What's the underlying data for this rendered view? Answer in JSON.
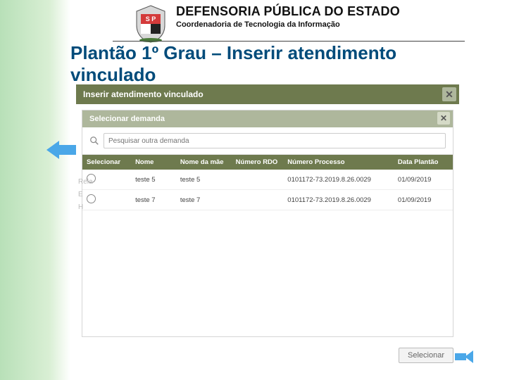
{
  "header": {
    "org": "DEFENSORIA PÚBLICA DO ESTADO",
    "sub": "Coordenadoria de Tecnologia da Informação"
  },
  "page_title_line1": "Plantão 1º Grau – Inserir atendimento",
  "page_title_line2": "vinculado",
  "modal": {
    "title": "Inserir atendimento vinculado",
    "close": "✕",
    "sub_title": "Selecionar demanda",
    "search_placeholder": "Pesquisar outra demanda"
  },
  "table": {
    "headers": {
      "sel": "Selecionar",
      "nome": "Nome",
      "mae": "Nome da mãe",
      "rdo": "Número RDO",
      "proc": "Número Processo",
      "blank": "",
      "data": "Data Plantão"
    },
    "rows": [
      {
        "nome": "teste 5",
        "mae": "teste 5",
        "rdo": "",
        "proc": "0101172-73.2019.8.26.0029",
        "data": "01/09/2019"
      },
      {
        "nome": "teste 7",
        "mae": "teste 7",
        "rdo": "",
        "proc": "0101172-73.2019.8.26.0029",
        "data": "01/09/2019"
      }
    ]
  },
  "footer": {
    "select_btn": "Selecionar"
  },
  "ghost": {
    "rela": "Rela",
    "e": "E",
    "h": "H"
  }
}
